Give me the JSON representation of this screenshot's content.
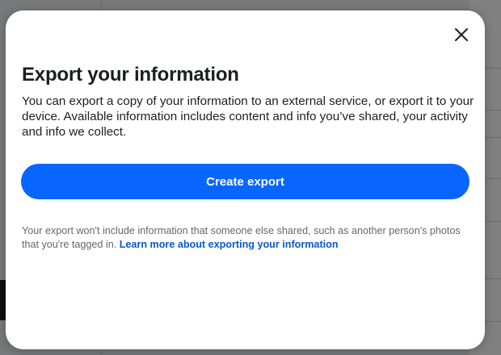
{
  "modal": {
    "title": "Export your information",
    "description": "You can export a copy of your information to an external service, or export it to your device. Available information includes content and info you’ve shared, your activity and info we collect.",
    "primary_button_label": "Create export",
    "note_text": "Your export won't include information that someone else shared, such as another person's photos that you're tagged in.",
    "note_link_label": "Learn more about exporting your information",
    "close_icon": "close-icon"
  },
  "colors": {
    "primary": "#0866ff",
    "link": "#0a58ca",
    "text": "#1c1e21",
    "muted_text": "#65676b"
  }
}
